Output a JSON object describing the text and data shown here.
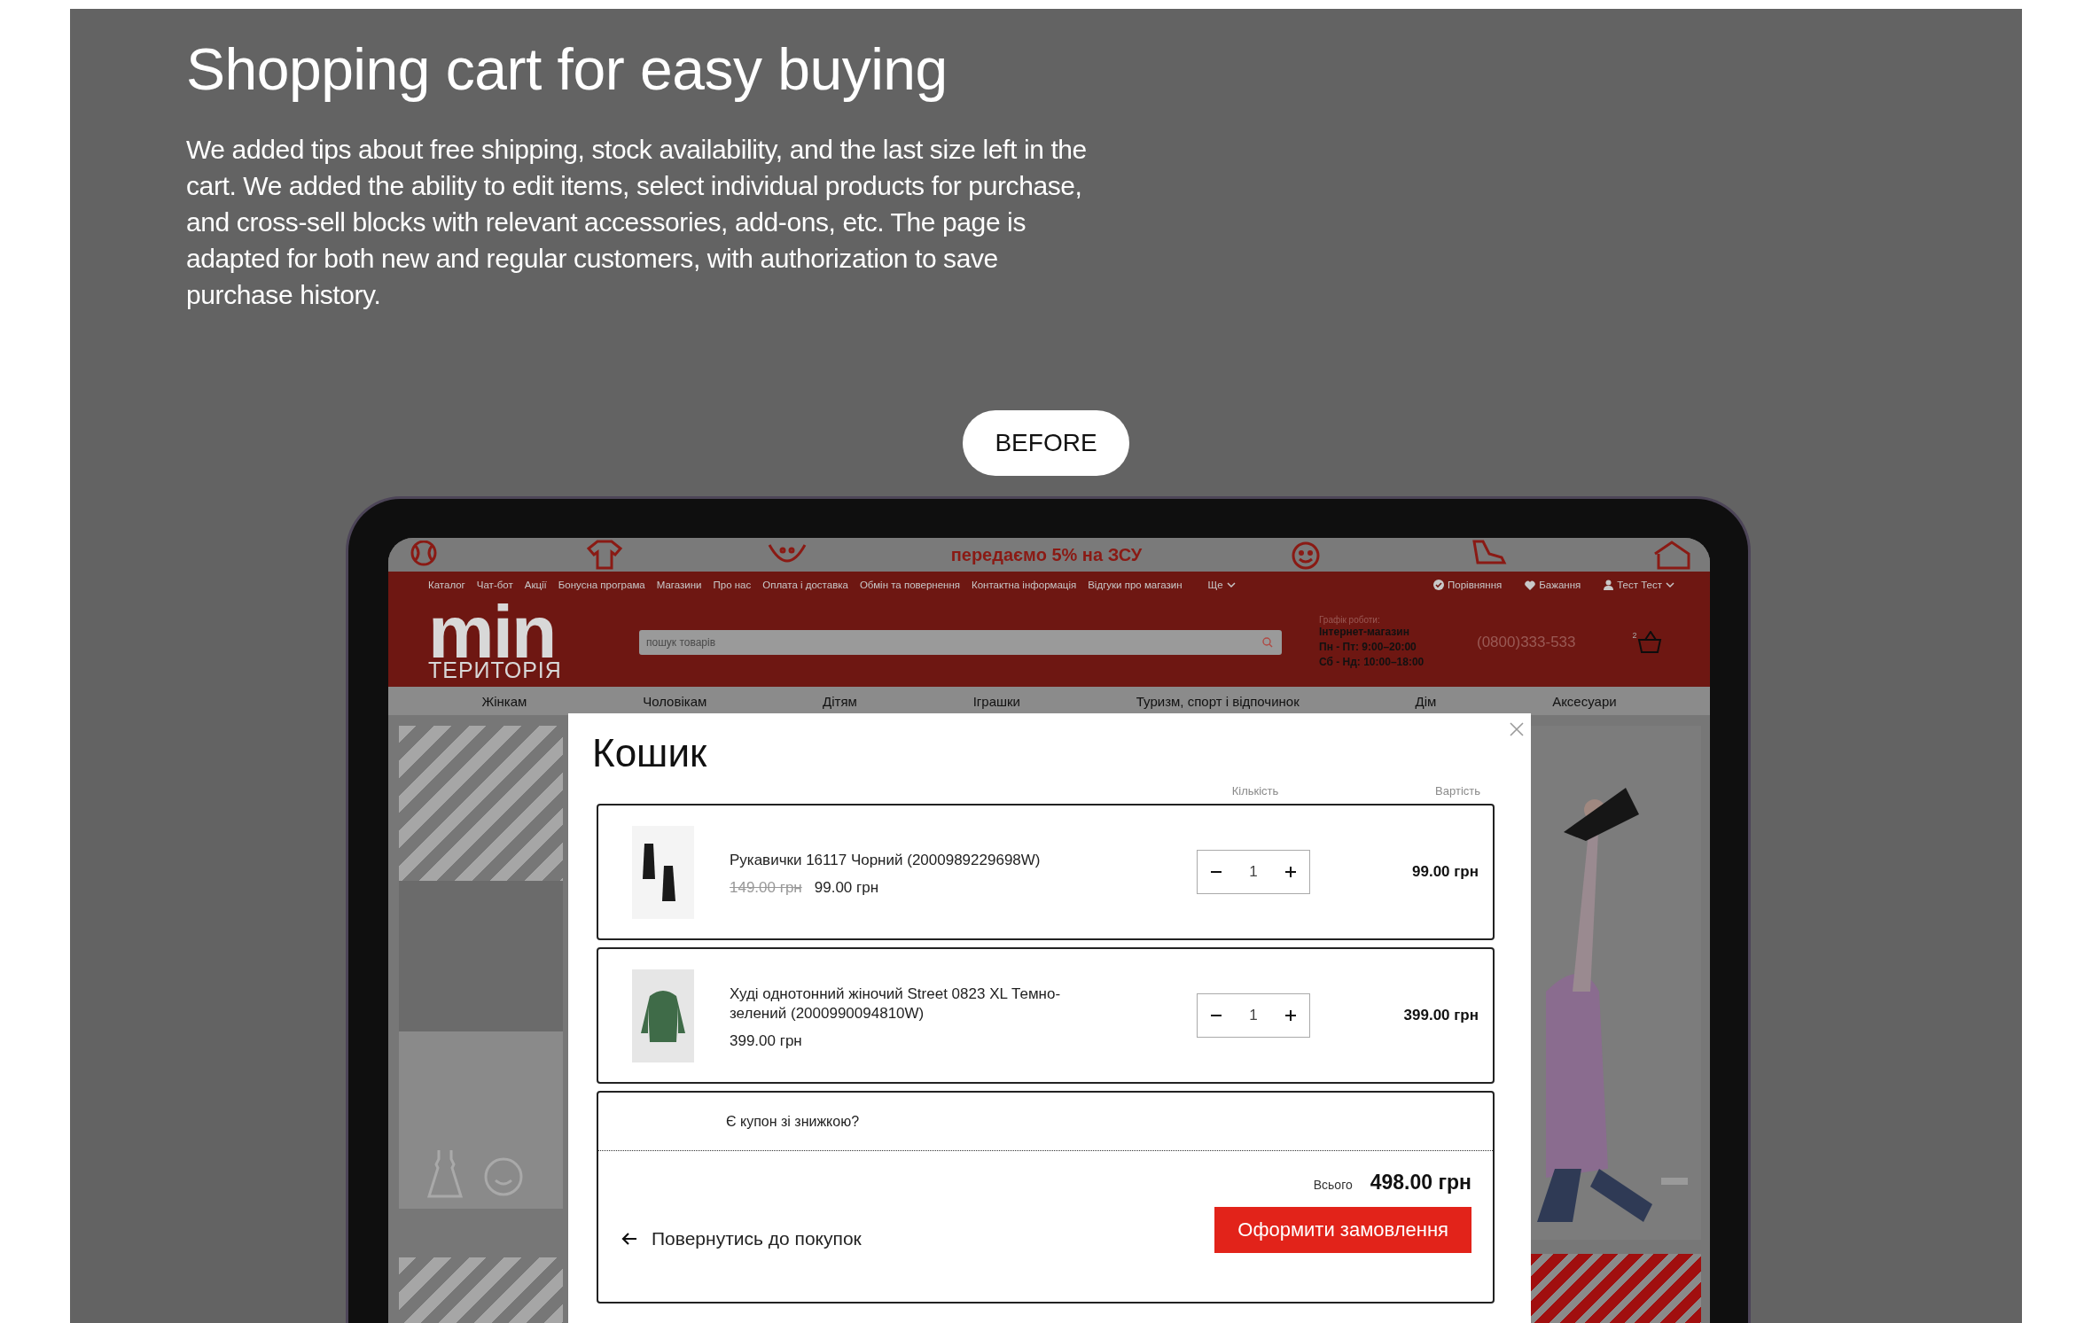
{
  "header": {
    "title": "Shopping cart for easy buying",
    "description": "We added tips about free shipping, stock availability, and the last size left in the cart. We added the ability to edit items, select individual products for purchase, and cross-sell blocks with relevant accessories, add-ons, etc. The page is adapted for both new and regular customers, with authorization to save purchase history."
  },
  "badge": "BEFORE",
  "site": {
    "promo": "передаємо **5%** на **ЗСУ**",
    "top_links": [
      "Каталог",
      "Чат-бот",
      "Акції",
      "Бонусна програма",
      "Магазини",
      "Про нас",
      "Оплата і доставка",
      "Обмін та повернення",
      "Контактна інформація",
      "Відгуки про магазин"
    ],
    "more": "Ще",
    "account_links": [
      "Порівняння",
      "Бажання",
      "Тест Тест"
    ],
    "logo": {
      "primary": "min",
      "secondary": "ТЕРИТОРІЯ"
    },
    "search": {
      "placeholder": "пошук товарів"
    },
    "schedule": {
      "title": "Графік роботи:",
      "lines": [
        "Інтернет-магазин",
        "Пн - Пт: 9:00–20:00",
        "Сб - Нд: 10:00–18:00"
      ]
    },
    "phone": "(0800)333-533",
    "cart_count": "2",
    "categories": [
      "Жінкам",
      "Чоловікам",
      "Дітям",
      "Іграшки",
      "Туризм, спорт і відпочинок",
      "Дім",
      "Аксесуари"
    ]
  },
  "cart": {
    "title": "Кошик",
    "columns": [
      "Кількість",
      "Вартість"
    ],
    "items": [
      {
        "name": "Рукавички 16117 Чорний (2000989229698W)",
        "old_price": "149.00 грн",
        "price": "99.00 грн",
        "quantity": "1",
        "total": "99.00 грн"
      },
      {
        "name": "Худі однотонний жіночий Street 0823 XL Темно-зелений (2000990094810W)",
        "price": "399.00 грн",
        "quantity": "1",
        "total": "399.00 грн"
      }
    ],
    "coupon": "Є купон зі знижкою?",
    "total_label": "Всього",
    "total": "498.00 грн",
    "back_link": "Повернутись до покупок",
    "checkout": "Оформити замовлення"
  }
}
